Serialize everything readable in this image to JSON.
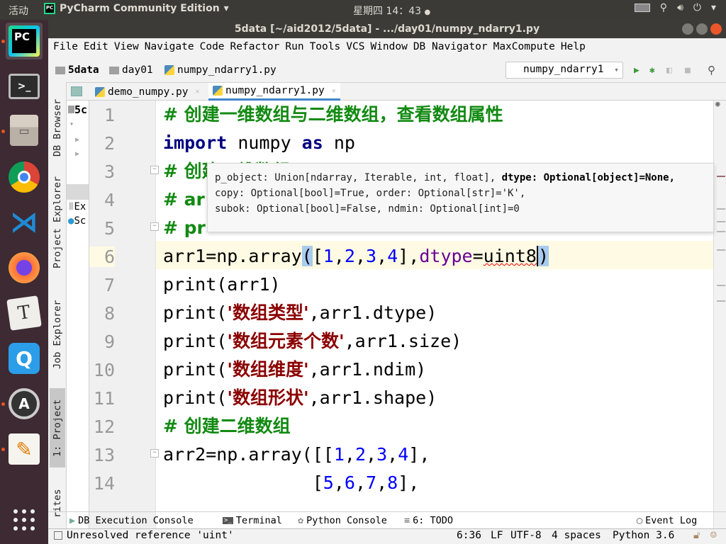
{
  "topbar": {
    "activities": "活动",
    "app_name": "PyCharm Community Edition",
    "app_menu_arrow": "▾",
    "clock": "星期四 14：43",
    "tray_icons": [
      "keyboard-icon",
      "network-icon",
      "volume-icon",
      "power-icon"
    ]
  },
  "dock": {
    "items": [
      {
        "name": "pycharm",
        "label": "PC",
        "active": true
      },
      {
        "name": "terminal",
        "label": ">_"
      },
      {
        "name": "files",
        "label": "▭"
      },
      {
        "name": "chrome",
        "label": "●"
      },
      {
        "name": "vscode",
        "label": "⋊"
      },
      {
        "name": "firefox",
        "label": "◉"
      },
      {
        "name": "typora",
        "label": "T"
      },
      {
        "name": "app-blue",
        "label": "Q"
      },
      {
        "name": "software-updater",
        "label": "A"
      },
      {
        "name": "text-editor",
        "label": "✎"
      }
    ],
    "show_apps": "⋮⋮⋮"
  },
  "window": {
    "title": "5data [~/aid2012/5data] - .../day01/numpy_ndarry1.py"
  },
  "menubar": {
    "items": [
      "File",
      "Edit",
      "View",
      "Navigate",
      "Code",
      "Refactor",
      "Run",
      "Tools",
      "VCS",
      "Window",
      "DB Navigator",
      "MaxCompute",
      "Help"
    ]
  },
  "navbar": {
    "breadcrumbs": [
      "5data",
      "day01",
      "numpy_ndarry1.py"
    ],
    "run_config": "numpy_ndarry1",
    "run_config_arrow": "▾"
  },
  "tabs": [
    {
      "label": "demo_numpy.py",
      "active": false
    },
    {
      "label": "numpy_ndarry1.py",
      "active": true
    }
  ],
  "left_strip": {
    "tabs": [
      "DB Browser",
      "Project Explorer",
      "Job Explorer",
      "1: Project",
      "rites"
    ]
  },
  "project_panel": {
    "items": [
      "5c",
      "Ex",
      "Sc"
    ]
  },
  "editor": {
    "line_numbers": [
      "1",
      "2",
      "3",
      "4",
      "5",
      "6",
      "7",
      "8",
      "9",
      "10",
      "11",
      "12",
      "13",
      "14"
    ],
    "lines": {
      "l1": "# 创建一维数组与二维数组，查看数组属性",
      "l2_import": "import",
      "l2_mod": " numpy ",
      "l2_as": "as",
      "l2_alias": " np",
      "l3": "# 创建一维数组",
      "l4": "# ar",
      "l5": "# pr",
      "l6_a": "arr1=np.array",
      "l6_p1": "(",
      "l6_b1": "[",
      "l6_n1": "1",
      "l6_c1": ",",
      "l6_n2": "2",
      "l6_c2": ",",
      "l6_n3": "3",
      "l6_c3": ",",
      "l6_n4": "4",
      "l6_b2": "],",
      "l6_kw": "dtype",
      "l6_eq": "=",
      "l6_val": "uint8",
      "l6_p2": ")",
      "l7": "print(arr1)",
      "l8_a": "print(",
      "l8_s": "'数组类型'",
      "l8_b": ",arr1.dtype)",
      "l9_a": "print(",
      "l9_s": "'数组元素个数'",
      "l9_b": ",arr1.size)",
      "l10_a": "print(",
      "l10_s": "'数组维度'",
      "l10_b": ",arr1.ndim)",
      "l11_a": "print(",
      "l11_s": "'数组形状'",
      "l11_b": ",arr1.shape)",
      "l12": "# 创建二维数组",
      "l13_a": "arr2=np.array([[",
      "l13_n": [
        "1",
        "2",
        "3",
        "4"
      ],
      "l13_b": "],",
      "l14_a": "              [",
      "l14_n": [
        "5",
        "6",
        "7",
        "8"
      ],
      "l14_b": "],"
    }
  },
  "param_popup": {
    "line1_a": "p_object: Union[ndarray, Iterable, int, float], ",
    "line1_b": "dtype: Optional[object]=None,",
    "line2": "copy: Optional[bool]=True, order: Optional[str]='K',",
    "line3": "subok: Optional[bool]=False, ndmin: Optional[int]=0"
  },
  "bottom_tools": {
    "db_console": "DB Execution Console",
    "terminal": "Terminal",
    "python_console": "Python Console",
    "todo": "6: TODO",
    "event_log": "Event Log"
  },
  "statusbar": {
    "message": "Unresolved reference 'uint'",
    "position": "6:36",
    "line_sep": "LF",
    "encoding": "UTF-8",
    "indent": "4 spaces",
    "interpreter": "Python 3.6"
  }
}
